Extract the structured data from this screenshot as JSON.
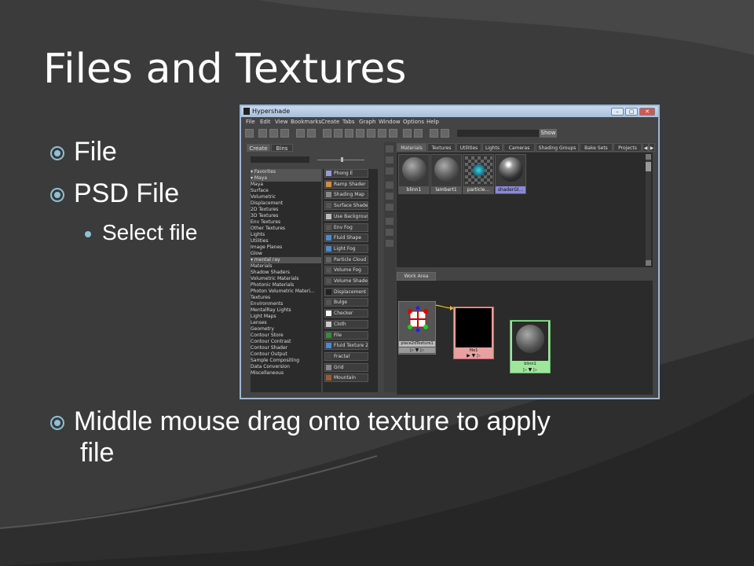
{
  "slide": {
    "title": "Files and Textures",
    "bullets": [
      {
        "text": "File",
        "level": 1
      },
      {
        "text": "PSD File",
        "level": 1
      },
      {
        "text": "Select file",
        "level": 2
      },
      {
        "text": "Middle mouse drag onto texture to apply",
        "level": 1,
        "continuation": "file"
      }
    ]
  },
  "window": {
    "title": "Hypershade",
    "menu": [
      "File",
      "Edit",
      "View",
      "Bookmarks",
      "Create",
      "Tabs",
      "Graph",
      "Window",
      "Options",
      "Help"
    ],
    "show_button": "Show",
    "left_tabs": [
      "Create",
      "Bins"
    ],
    "tree_items": [
      "Favorites",
      "Maya",
      "Maya",
      "Surface",
      "Volumetric",
      "Displacement",
      "2D Textures",
      "3D Textures",
      "Env Textures",
      "Other Textures",
      "Lights",
      "Utilities",
      "Image Planes",
      "Glow",
      "mental ray",
      "Materials",
      "Shadow Shaders",
      "Volumetric Materials",
      "Photonic Materials",
      "Photon Volumetric Materi...",
      "Textures",
      "Environments",
      "MentalRay Lights",
      "Light Maps",
      "Lenses",
      "Geometry",
      "Contour Store",
      "Contour Contrast",
      "Contour Shader",
      "Contour Output",
      "Sample Compositing",
      "Data Conversion",
      "Miscellaneous"
    ],
    "node_items": [
      "Phong E",
      "Ramp Shader",
      "Shading Map",
      "Surface Shader",
      "Use Background",
      "Env Fog",
      "Fluid Shape",
      "Light Fog",
      "Particle Cloud",
      "Volume Fog",
      "Volume Shader",
      "Displacement",
      "Bulge",
      "Checker",
      "Cloth",
      "File",
      "Fluid Texture 2D",
      "Fractal",
      "Grid",
      "Mountain"
    ],
    "right_tabs": [
      "Materials",
      "Textures",
      "Utilities",
      "Lights",
      "Cameras",
      "Shading Groups",
      "Bake Sets",
      "Projects"
    ],
    "materials": [
      "blinn1",
      "lambert1",
      "particle...",
      "shaderGl..."
    ],
    "work_area_tab": "Work Area",
    "work_nodes": [
      "place2dTexture1",
      "file1",
      "blinn1"
    ],
    "colors": {
      "accent_bullet": "#8fc1d6",
      "selected_swatch": "#8a8ad8",
      "file_node": "#e8a0a0",
      "blinn_node": "#9ee69e"
    }
  }
}
